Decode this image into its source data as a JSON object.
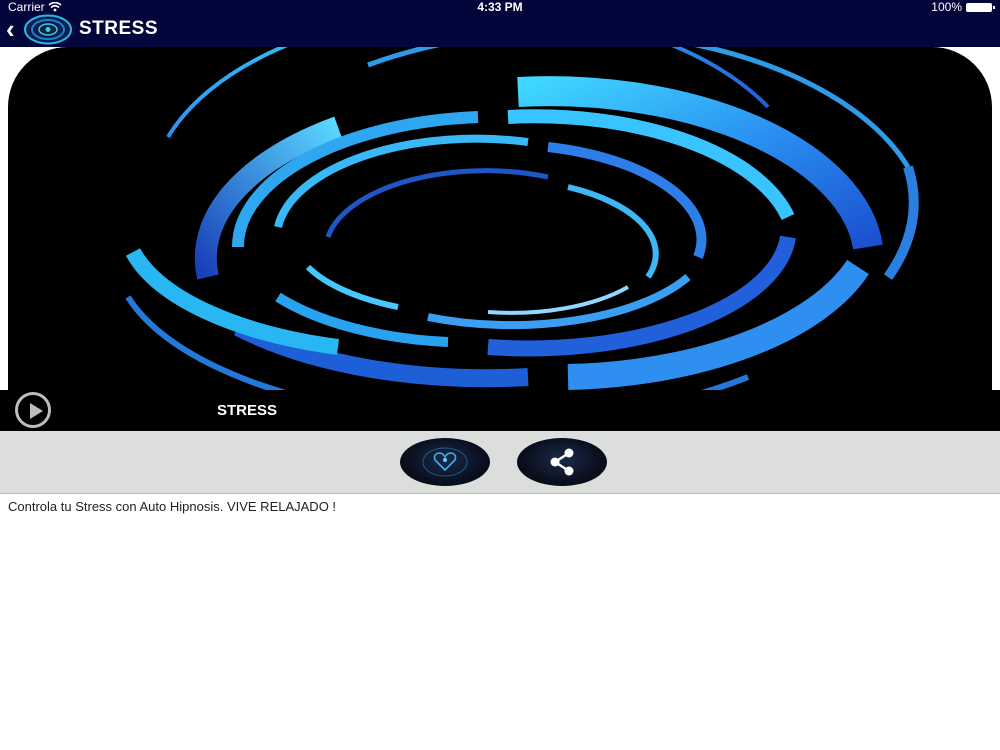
{
  "status_bar": {
    "carrier": "Carrier",
    "time": "4:33 PM",
    "battery": "100%"
  },
  "nav": {
    "title": "STRESS"
  },
  "player": {
    "title": "STRESS"
  },
  "description": "Controla tu Stress con Auto Hipnosis. VIVE RELAJADO !",
  "colors": {
    "nav_bg": "#03063a",
    "ring_light": "#29c6f0",
    "ring_dark": "#1f5fd6",
    "strip_bg": "#dcdedc"
  }
}
